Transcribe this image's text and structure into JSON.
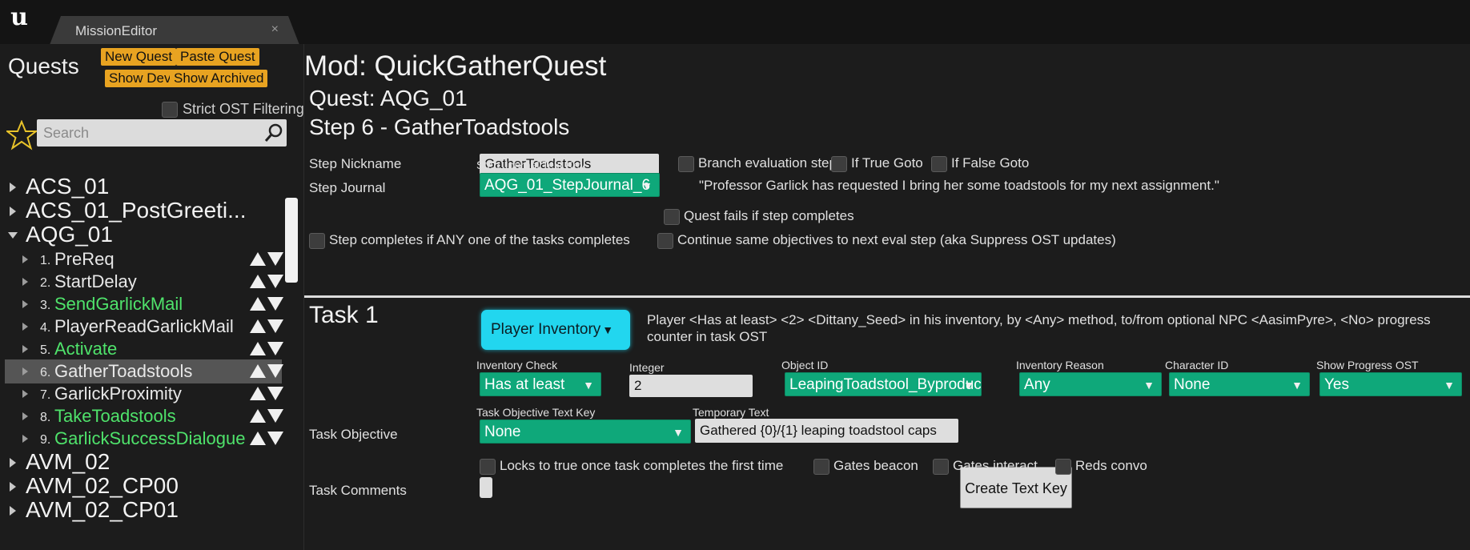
{
  "window": {
    "logo_icon": "unreal-logo-icon",
    "tab_title": "MissionEditor",
    "tab_close": "×"
  },
  "sidebar": {
    "title": "Quests",
    "new_quest": "New Quest",
    "paste_quest": "Paste Quest",
    "show_dev": "Show Dev",
    "show_archived": "Show Archived",
    "strict_filter": "Strict OST Filtering",
    "search_placeholder": "Search",
    "quests_top": [
      "ACS_01",
      "ACS_01_PostGreeti...",
      "AQG_01"
    ],
    "steps": [
      {
        "num": "1.",
        "name": "PreReq",
        "color": "#f2f2f2"
      },
      {
        "num": "2.",
        "name": "StartDelay",
        "color": "#f2f2f2"
      },
      {
        "num": "3.",
        "name": "SendGarlickMail",
        "color": "#4fe36b"
      },
      {
        "num": "4.",
        "name": "PlayerReadGarlickMail",
        "color": "#f2f2f2"
      },
      {
        "num": "5.",
        "name": "Activate",
        "color": "#4fe36b"
      },
      {
        "num": "6.",
        "name": "GatherToadstools",
        "color": "#f2f2f2"
      },
      {
        "num": "7.",
        "name": "GarlickProximity",
        "color": "#f2f2f2"
      },
      {
        "num": "8.",
        "name": "TakeToadstools",
        "color": "#4fe36b"
      },
      {
        "num": "9.",
        "name": "GarlickSuccessDialogue",
        "color": "#4fe36b"
      }
    ],
    "quests_bottom": [
      "AVM_02",
      "AVM_02_CP00",
      "AVM_02_CP01"
    ]
  },
  "main": {
    "mod_title": "Mod: QuickGatherQuest",
    "quest_title": "Quest: AQG_01",
    "step_title": "Step 6 - GatherToadstools",
    "step_nickname_label": "Step Nickname",
    "step_nickname_value": "GatherToadstools",
    "branch_eval": "Branch evaluation step",
    "if_true": "If True Goto",
    "if_false": "If False Goto",
    "journal_key_label": "Step Journal Text Key",
    "step_journal_label": "Step Journal",
    "journal_key_value": "AQG_01_StepJournal_6",
    "journal_text": "\"Professor Garlick has requested I bring her some toadstools for my next assignment.\"",
    "quest_fails": "Quest fails if step completes",
    "any_task": "Step completes if ANY one of the tasks completes",
    "continue_same": "Continue same objectives to next eval step (aka Suppress OST updates)"
  },
  "task": {
    "title": "Task 1",
    "type_button": "Player Inventory",
    "description": "Player <Has at least> <2> <Dittany_Seed> in his inventory, by <Any> method, to/from optional NPC <AasimPyre>, <No> progress counter in task OST",
    "inventory_check_label": "Inventory Check",
    "inventory_check_value": "Has at least",
    "integer_label": "Integer",
    "integer_value": "2",
    "object_id_label": "Object ID",
    "object_id_value": "LeapingToadstool_Byproduct",
    "inventory_reason_label": "Inventory Reason",
    "inventory_reason_value": "Any",
    "character_id_label": "Character ID",
    "character_id_value": "None",
    "show_progress_label": "Show Progress OST",
    "show_progress_value": "Yes",
    "objective_key_label": "Task Objective Text Key",
    "task_objective_label": "Task Objective",
    "objective_key_value": "None",
    "temp_text_label": "Temporary Text",
    "temp_text_value": "Gathered {0}/{1} leaping toadstool caps",
    "create_text_key": "Create Text Key",
    "locks_true": "Locks to true once task completes the first time",
    "gates_beacon": "Gates beacon",
    "gates_interact": "Gates interact",
    "reds_convo": "Reds convo",
    "comments_label": "Task Comments"
  },
  "colors": {
    "accent_orange": "#e8a321",
    "combo_green": "#0fa87a",
    "step_green": "#4fe36b",
    "inventory_cyan": "#22d6ef"
  }
}
